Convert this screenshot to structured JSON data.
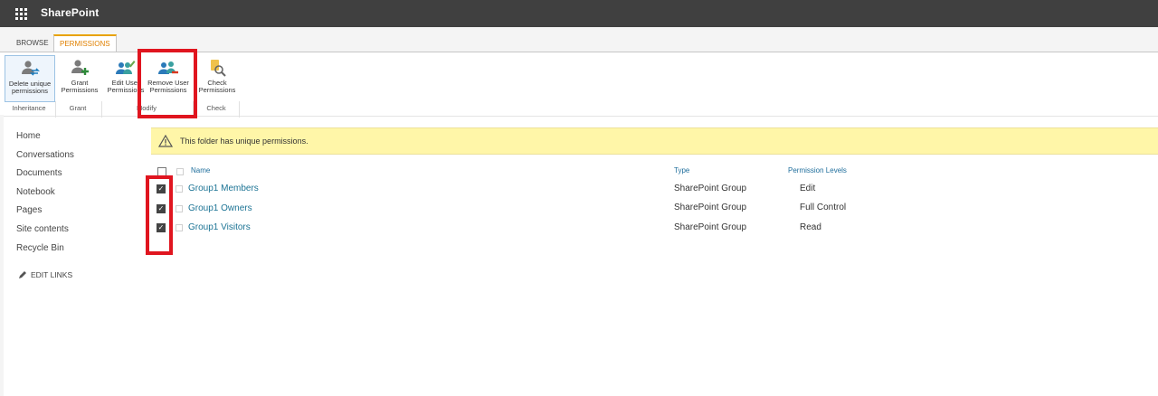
{
  "suite": {
    "app_name": "SharePoint",
    "waffle_icon": "app-launcher-icon"
  },
  "ribbon": {
    "tabs": [
      {
        "label": "BROWSE",
        "selected": false
      },
      {
        "label": "PERMISSIONS",
        "selected": true
      }
    ],
    "buttons": {
      "delete_unique": {
        "line1": "Delete unique",
        "line2": "permissions"
      },
      "grant": {
        "line1": "Grant",
        "line2": "Permissions"
      },
      "edit_user": {
        "line1": "Edit User",
        "line2": "Permissions"
      },
      "remove_user": {
        "line1": "Remove User",
        "line2": "Permissions"
      },
      "check": {
        "line1": "Check",
        "line2": "Permissions"
      }
    },
    "groups": {
      "inheritance": "Inheritance",
      "grant": "Grant",
      "modify": "Modify",
      "check": "Check"
    }
  },
  "nav": {
    "links": [
      "Home",
      "Conversations",
      "Documents",
      "Notebook",
      "Pages",
      "Site contents",
      "Recycle Bin"
    ],
    "edit_links": "EDIT LINKS"
  },
  "banner": {
    "message": "This folder has unique permissions.",
    "icon": "warning-icon"
  },
  "list": {
    "columns": {
      "name": "Name",
      "type": "Type",
      "levels": "Permission Levels"
    },
    "rows": [
      {
        "name": "Group1 Members",
        "type": "SharePoint Group",
        "level": "Edit",
        "checked": true
      },
      {
        "name": "Group1 Owners",
        "type": "SharePoint Group",
        "level": "Full Control",
        "checked": true
      },
      {
        "name": "Group1 Visitors",
        "type": "SharePoint Group",
        "level": "Read",
        "checked": true
      }
    ]
  },
  "colors": {
    "suite_bar": "#404040",
    "tab_accent": "#e8a200",
    "highlight": "#e0151f",
    "link": "#1b7394",
    "banner": "#fff6a8"
  }
}
